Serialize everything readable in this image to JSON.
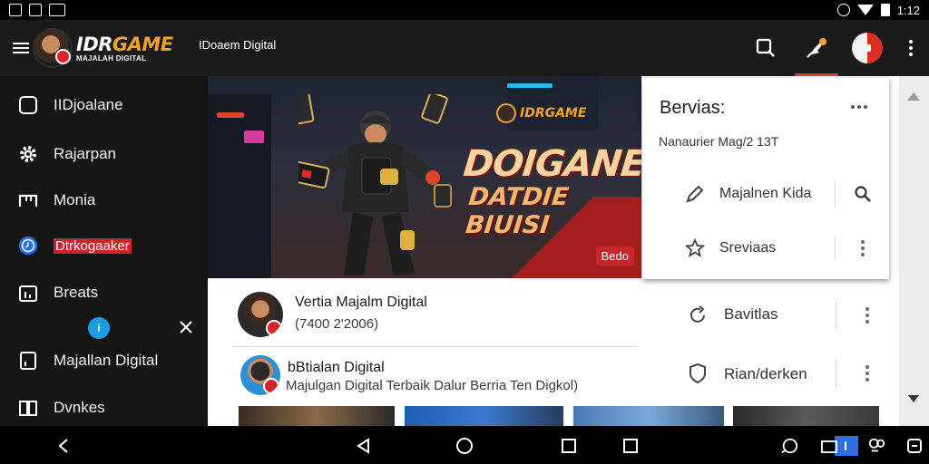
{
  "status_bar": {
    "time": "1:12"
  },
  "app_bar": {
    "logo_title_a": "IDR",
    "logo_title_b": "GAME",
    "logo_subtitle": "MAJALAH DIGITAL",
    "title": "IDoaem Digital"
  },
  "sidebar": {
    "items": [
      {
        "label": "IIDjoalane",
        "icon": "square-icon"
      },
      {
        "label": "Rajarpan",
        "icon": "gear-icon"
      },
      {
        "label": "Monia",
        "icon": "calendar-icon"
      },
      {
        "label": "Dtrkogaaker",
        "icon": "clock-icon"
      },
      {
        "label": "Breats",
        "icon": "chart-icon"
      },
      {
        "label": "Majallan Digital",
        "icon": "magazine-icon"
      },
      {
        "label": "Dvnkes",
        "icon": "book-icon"
      }
    ],
    "notice_glyph": "i"
  },
  "hero": {
    "brand": "IDRGAME",
    "title": "DOIGANER",
    "subtitle": "DATDIE BIUISI",
    "badge": "Bedo"
  },
  "card": {
    "title": "Bervias:",
    "subtitle": "Nanaurier Mag/2 13T",
    "rows": [
      {
        "label": "Majalnen Kida",
        "icon": "pencil-icon",
        "action_icon": "search-icon"
      },
      {
        "label": "Sreviaas",
        "icon": "star-icon",
        "action_icon": "more-vert-icon"
      }
    ]
  },
  "list": [
    {
      "title": "Vertia Majalm Digital",
      "subtitle": "(7400 2'2006)",
      "action_label": "Bavitlas",
      "action_icon": "refresh-icon"
    },
    {
      "title": "bBtialan Digital",
      "subtitle": "Majulgan Digital Terbaik Dalur Berria Ten Digkol)",
      "action_label": "Rian/derken",
      "action_icon": "shield-icon"
    }
  ],
  "colors": {
    "accent_red": "#c8262c",
    "accent_orange": "#f2a22c",
    "active_blue": "#1e6ff0"
  }
}
